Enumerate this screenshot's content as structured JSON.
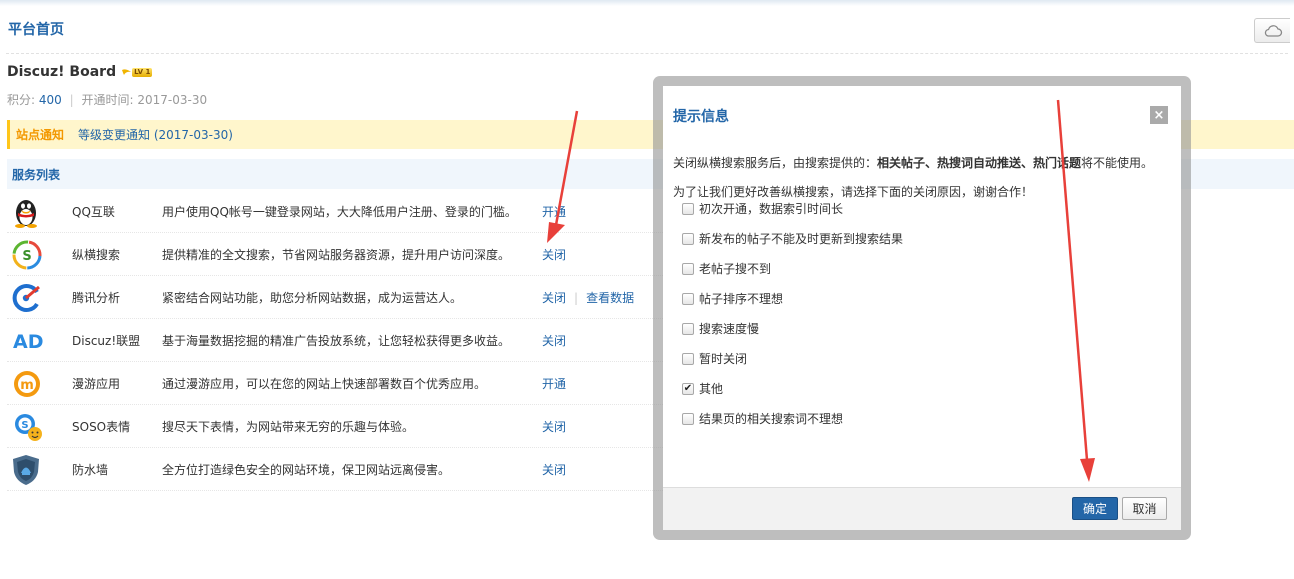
{
  "page": {
    "title": "平台首页"
  },
  "board": {
    "name": "Discuz! Board",
    "level": "LV 1",
    "score_label": "积分:",
    "score": "400",
    "separator": "|",
    "open_time_label": "开通时间:",
    "open_time": "2017-03-30"
  },
  "notice": {
    "label": "站点通知",
    "text": "等级变更通知 (2017-03-30)"
  },
  "services": {
    "header": "服务列表",
    "items": [
      {
        "icon": "qq-penguin-icon",
        "name": "QQ互联",
        "desc": "用户使用QQ帐号一键登录网站，大大降低用户注册、登录的门槛。",
        "actions": [
          "开通"
        ]
      },
      {
        "icon": "zongheng-search-icon",
        "name": "纵横搜索",
        "desc": "提供精准的全文搜索，节省网站服务器资源，提升用户访问深度。",
        "actions": [
          "关闭"
        ]
      },
      {
        "icon": "tencent-analytics-icon",
        "name": "腾讯分析",
        "desc": "紧密结合网站功能，助您分析网站数据，成为运营达人。",
        "actions": [
          "关闭",
          "查看数据"
        ]
      },
      {
        "icon": "ad-icon",
        "name": "Discuz!联盟",
        "desc": "基于海量数据挖掘的精准广告投放系统，让您轻松获得更多收益。",
        "actions": [
          "关闭"
        ]
      },
      {
        "icon": "manyou-icon",
        "name": "漫游应用",
        "desc": "通过漫游应用，可以在您的网站上快速部署数百个优秀应用。",
        "actions": [
          "开通"
        ]
      },
      {
        "icon": "soso-emoticon-icon",
        "name": "SOSO表情",
        "desc": "搜尽天下表情，为网站带来无穷的乐趣与体验。",
        "actions": [
          "关闭"
        ]
      },
      {
        "icon": "firewall-shield-icon",
        "name": "防水墙",
        "desc": "全方位打造绿色安全的网站环境，保卫网站远离侵害。",
        "actions": [
          "关闭"
        ]
      }
    ]
  },
  "dialog": {
    "title": "提示信息",
    "close": "×",
    "line1_pre": "关闭纵横搜索服务后，由搜索提供的：",
    "line1_bold": "相关帖子、热搜词自动推送、热门话题",
    "line1_post": "将不能使用。",
    "line2": "为了让我们更好改善纵横搜索，请选择下面的关闭原因，谢谢合作！",
    "reasons": [
      {
        "label": "初次开通，数据索引时间长",
        "checked": false
      },
      {
        "label": "新发布的帖子不能及时更新到搜索结果",
        "checked": false
      },
      {
        "label": "老帖子搜不到",
        "checked": false
      },
      {
        "label": "帖子排序不理想",
        "checked": false
      },
      {
        "label": "搜索速度慢",
        "checked": false
      },
      {
        "label": "暂时关闭",
        "checked": false
      },
      {
        "label": "其他",
        "checked": true
      },
      {
        "label": "结果页的相关搜索词不理想",
        "checked": false
      }
    ],
    "ok": "确定",
    "cancel": "取消"
  },
  "colors": {
    "link": "#2366a8",
    "notice_bg": "#fff6cc",
    "notice_label": "#f39800",
    "annotation_arrow": "#e8403a"
  }
}
